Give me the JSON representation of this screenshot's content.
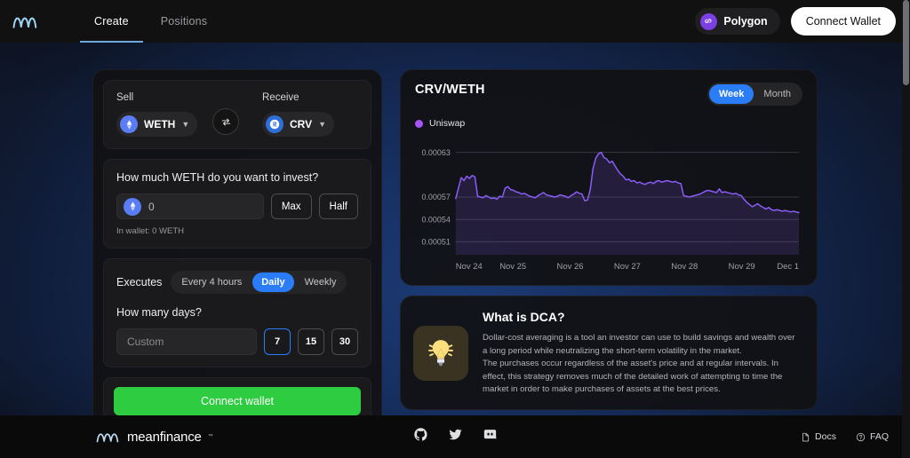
{
  "nav": {
    "logo": "meanfinance-logo",
    "tabs": [
      {
        "label": "Create",
        "active": true
      },
      {
        "label": "Positions",
        "active": false
      }
    ],
    "network": {
      "label": "Polygon",
      "icon": "polygon-icon",
      "color": "#7b3fe4"
    },
    "connect_wallet": "Connect Wallet"
  },
  "swap": {
    "sell_label": "Sell",
    "sell_token": "WETH",
    "sell_token_icon": "weth-icon",
    "receive_label": "Receive",
    "receive_token": "CRV",
    "receive_token_icon": "crv-icon",
    "toggle_icon": "swap-arrows-icon"
  },
  "invest": {
    "question": "How much WETH do you want to invest?",
    "amount_value": "0",
    "amount_placeholder": "0",
    "amount_token_icon": "weth-icon",
    "max_label": "Max",
    "half_label": "Half",
    "wallet_note": "In wallet: 0 WETH"
  },
  "frequency": {
    "executes_label": "Executes",
    "options": [
      {
        "label": "Every 4 hours",
        "active": false
      },
      {
        "label": "Daily",
        "active": true
      },
      {
        "label": "Weekly",
        "active": false
      }
    ],
    "days_question": "How many days?",
    "custom_placeholder": "Custom",
    "custom_value": "",
    "day_presets": [
      {
        "label": "7",
        "selected": true
      },
      {
        "label": "15",
        "selected": false
      },
      {
        "label": "30",
        "selected": false
      }
    ]
  },
  "cta": {
    "label": "Connect wallet",
    "color": "#2ecc40"
  },
  "chart_panel": {
    "title": "CRV/WETH",
    "ranges": [
      {
        "label": "Week",
        "active": true
      },
      {
        "label": "Month",
        "active": false
      }
    ],
    "legend": [
      {
        "label": "Uniswap",
        "color": "#a855f7"
      }
    ]
  },
  "chart_data": {
    "type": "line",
    "title": "CRV/WETH",
    "xlabel": "",
    "ylabel": "",
    "grid": true,
    "legend_position": "top-left",
    "series": [
      {
        "name": "Uniswap",
        "color": "#8b5cf6",
        "values": [
          0.000568,
          0.000582,
          0.000596,
          0.000592,
          0.000598,
          0.000595,
          0.000599,
          0.000597,
          0.000571,
          0.00057,
          0.000569,
          0.000572,
          0.00057,
          0.000568,
          0.000569,
          0.000567,
          0.000571,
          0.00057,
          0.000582,
          0.000584,
          0.00058,
          0.000579,
          0.000577,
          0.000576,
          0.000574,
          0.000575,
          0.000573,
          0.000571,
          0.00057,
          0.000569,
          0.000572,
          0.000574,
          0.000576,
          0.000573,
          0.000572,
          0.000571,
          0.00057,
          0.000571,
          0.000573,
          0.000572,
          0.000571,
          0.000569,
          0.000572,
          0.000574,
          0.000577,
          0.000575,
          0.000574,
          0.000565,
          0.000566,
          0.00058,
          0.000608,
          0.000622,
          0.000628,
          0.00063,
          0.000623,
          0.000621,
          0.000616,
          0.000618,
          0.000612,
          0.000606,
          0.000601,
          0.000598,
          0.000593,
          0.000594,
          0.000591,
          0.000592,
          0.000589,
          0.00059,
          0.000588,
          0.000587,
          0.000589,
          0.00059,
          0.000588,
          0.000591,
          0.000592,
          0.00059,
          0.000591,
          0.000592,
          0.000591,
          0.00059,
          0.000591,
          0.000589,
          0.000588,
          0.000572,
          0.000571,
          0.00057,
          0.000571,
          0.000572,
          0.000573,
          0.000574,
          0.000576,
          0.000578,
          0.000579,
          0.000578,
          0.000577,
          0.000576,
          0.000581,
          0.000576,
          0.000577,
          0.000576,
          0.000575,
          0.000574,
          0.000575,
          0.000573,
          0.000572,
          0.000567,
          0.000563,
          0.00056,
          0.000557,
          0.000559,
          0.000561,
          0.000558,
          0.000556,
          0.000554,
          0.000556,
          0.000553,
          0.000552,
          0.000553,
          0.000552,
          0.000551,
          0.000552,
          0.000551,
          0.00055,
          0.000551,
          0.00055,
          0.000549
        ]
      }
    ],
    "x": [
      "Nov 24",
      "Nov 25",
      "Nov 26",
      "Nov 27",
      "Nov 28",
      "Nov 29",
      "Dec 1"
    ],
    "xticks": [
      "Nov 24",
      "Nov 25",
      "Nov 26",
      "Nov 27",
      "Nov 28",
      "Nov 29",
      "Dec 1"
    ],
    "yticks": [
      "0.00063",
      "0.00057",
      "0.00054",
      "0.00051"
    ],
    "ytick_values": [
      0.00063,
      0.00057,
      0.00054,
      0.00051
    ],
    "ylim": [
      0.000495,
      0.000645
    ]
  },
  "dca_info": {
    "icon": "lightbulb-icon",
    "title": "What is DCA?",
    "paragraph1": "Dollar-cost averaging is a tool an investor can use to build savings and wealth over a long period while neutralizing the short-term volatility in the market.",
    "paragraph2": "The purchases occur regardless of the asset's price and at regular intervals. In effect, this strategy removes much of the detailed work of attempting to time the market in order to make purchases of assets at the best prices."
  },
  "footer": {
    "brand": "meanfinance",
    "trademark": "™",
    "socials": [
      {
        "name": "github-icon"
      },
      {
        "name": "twitter-icon"
      },
      {
        "name": "discord-icon"
      }
    ],
    "links": [
      {
        "label": "Docs",
        "icon": "document-icon"
      },
      {
        "label": "FAQ",
        "icon": "question-circle-icon"
      }
    ]
  }
}
